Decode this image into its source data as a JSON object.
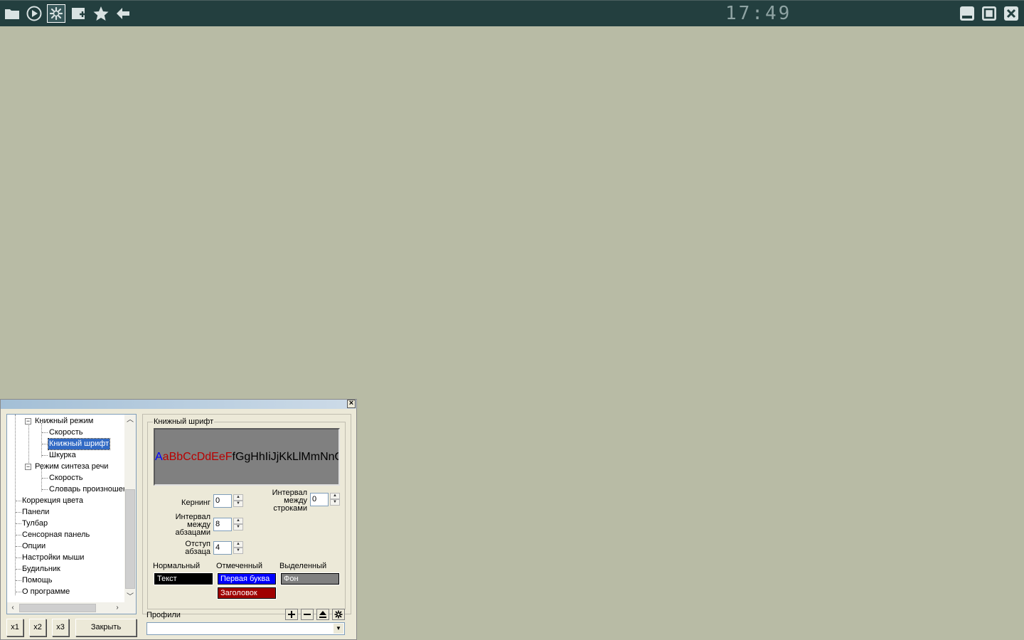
{
  "toolbar": {
    "icons": [
      "folder-icon",
      "play-icon",
      "settings-icon",
      "add-bookmark-icon",
      "star-icon",
      "back-arrow-icon"
    ],
    "clock": "17:49",
    "window_controls": [
      "minimize-icon",
      "maximize-icon",
      "close-icon"
    ],
    "colors": {
      "bar": "#233f3f",
      "icon": "#d9e2e2"
    }
  },
  "dialog": {
    "close_label": "×",
    "tree": {
      "items": [
        {
          "label": "Книжный режим",
          "level": 1,
          "expandable": true
        },
        {
          "label": "Скорость",
          "level": 2
        },
        {
          "label": "Книжный шрифт",
          "level": 2,
          "selected": true
        },
        {
          "label": "Шкурка",
          "level": 2
        },
        {
          "label": "Режим синтеза речи",
          "level": 1,
          "expandable": true
        },
        {
          "label": "Скорость",
          "level": 2
        },
        {
          "label": "Словарь произношен",
          "level": 2
        },
        {
          "label": "Коррекция цвета",
          "level": 0
        },
        {
          "label": "Панели",
          "level": 0
        },
        {
          "label": "Тулбар",
          "level": 0
        },
        {
          "label": "Сенсорная панель",
          "level": 0
        },
        {
          "label": "Опции",
          "level": 0
        },
        {
          "label": "Настройки мыши",
          "level": 0
        },
        {
          "label": "Будильник",
          "level": 0
        },
        {
          "label": "Помощь",
          "level": 0
        },
        {
          "label": "О программе",
          "level": 0
        }
      ],
      "expander_symbol": "−"
    },
    "font_group": {
      "title": "Книжный шрифт",
      "preview": {
        "first_letter": "A",
        "red_part": "aBbCcDdEeF",
        "normal_part": "fGgHhIiJjKkLlMmNnO",
        "colors": {
          "first": "#0000ff",
          "red": "#b80000",
          "normal": "#000000",
          "bg": "#808080"
        }
      },
      "kerning": {
        "label": "Кернинг",
        "value": "0"
      },
      "paragraph_interval": {
        "label_lines": [
          "Интервал",
          "между",
          "абзацами"
        ],
        "value": "8"
      },
      "indent": {
        "label_lines": [
          "Отступ",
          "абзаца"
        ],
        "value": "4"
      },
      "line_interval": {
        "label_lines": [
          "Интервал",
          "между",
          "строками"
        ],
        "value": "0"
      },
      "colors": {
        "normal_header": "Нормальный",
        "marked_header": "Отмеченный",
        "selected_header": "Выделенный",
        "text_box": {
          "label": "Текст",
          "bg": "#000000",
          "fg": "#ffffff"
        },
        "first_letter_box": {
          "label": "Первая буква",
          "bg": "#0000ff",
          "fg": "#ffffff"
        },
        "heading_box": {
          "label": "Заголовок",
          "bg": "#a00000",
          "fg": "#ffffff"
        },
        "background_box": {
          "label": "Фон",
          "bg": "#808080",
          "fg": "#ffffff"
        }
      }
    },
    "profiles": {
      "label": "Профили",
      "value": "",
      "buttons": [
        "add-profile-icon",
        "remove-profile-icon",
        "upload-profile-icon",
        "settings-profile-icon"
      ]
    },
    "buttons": {
      "x1": "x1",
      "x2": "x2",
      "x3": "x3",
      "close": "Закрыть"
    }
  }
}
